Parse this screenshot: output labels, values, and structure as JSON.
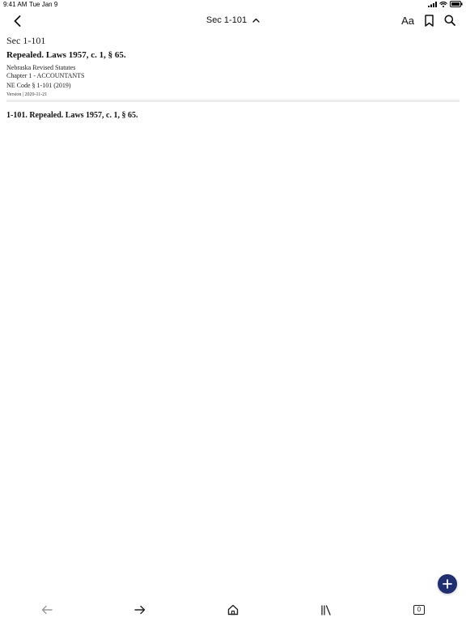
{
  "status_bar": {
    "time": "9:41 AM",
    "date": "Tue Jan 9"
  },
  "nav": {
    "title": "Sec 1-101",
    "text_size_label": "Aa",
    "icons": [
      "back-icon",
      "chevron-up-icon",
      "bookmark-icon",
      "search-icon"
    ]
  },
  "document": {
    "section": "Sec 1-101",
    "heading": "Repealed. Laws 1957, c. 1, § 65.",
    "source": "Nebraska Revised Statutes",
    "chapter": "Chapter 1 - ACCOUNTANTS",
    "code": "NE Code § 1-101 (2019)",
    "version": "Version | 2020-11-21",
    "body": "1-101. Repealed. Laws 1957, c. 1, § 65."
  },
  "toolbar": {
    "icons": [
      "back-arrow-icon",
      "forward-arrow-icon",
      "home-icon",
      "library-icon",
      "tabs-icon"
    ],
    "tab_count": "0"
  },
  "fab": {
    "icon": "plus-icon",
    "color": "#1f2f6f"
  }
}
